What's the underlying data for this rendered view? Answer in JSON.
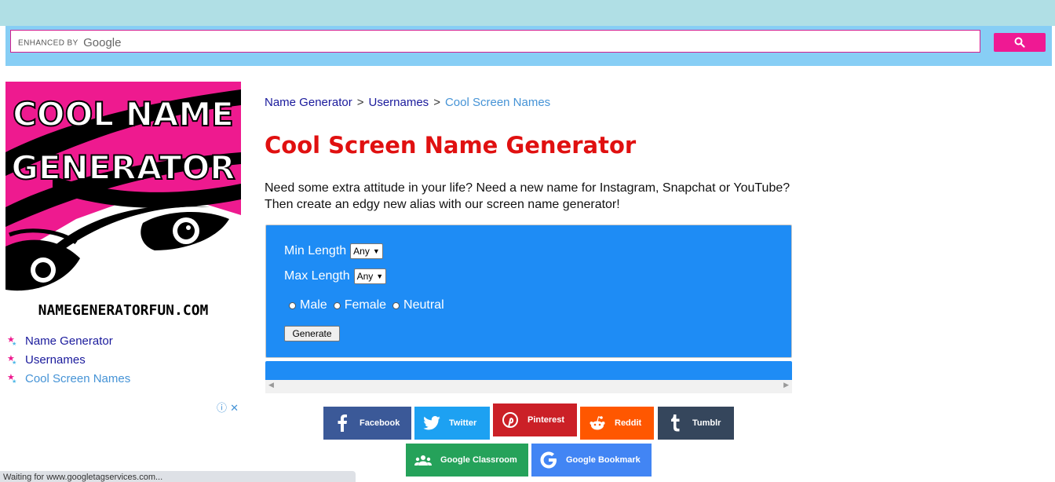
{
  "search": {
    "enhanced_label": "ENHANCED BY",
    "provider_label": "Google",
    "button_icon": "search-icon"
  },
  "logo": {
    "line1": "COOL NAME",
    "line2": "GENERATOR",
    "site": "NAMEGENERATORFUN.COM"
  },
  "sidebar": {
    "items": [
      {
        "label": "Name Generator"
      },
      {
        "label": "Usernames"
      },
      {
        "label": "Cool Screen Names"
      }
    ]
  },
  "breadcrumb": {
    "items": [
      "Name Generator",
      "Usernames",
      "Cool Screen Names"
    ],
    "separator": ">"
  },
  "page": {
    "title": "Cool Screen Name Generator",
    "intro": "Need some extra attitude in your life? Need a new name for Instagram, Snapchat or YouTube? Then create an edgy new alias with our screen name generator!"
  },
  "form": {
    "min_length_label": "Min Length",
    "min_length_value": "Any",
    "max_length_label": "Max Length",
    "max_length_value": "Any",
    "genders": [
      "Male",
      "Female",
      "Neutral"
    ],
    "selected_gender": "Male",
    "generate_label": "Generate"
  },
  "share": {
    "facebook": "Facebook",
    "twitter": "Twitter",
    "pinterest": "Pinterest",
    "reddit": "Reddit",
    "tumblr": "Tumblr",
    "classroom": "Google Classroom",
    "bookmark": "Google Bookmark"
  },
  "status_bar": {
    "text": "Waiting for www.googletagservices.com..."
  },
  "colors": {
    "title_red": "#e01010",
    "panel_blue": "#1e8cf5",
    "search_pink": "#ef1993",
    "link_blue": "#1a1a9c"
  }
}
